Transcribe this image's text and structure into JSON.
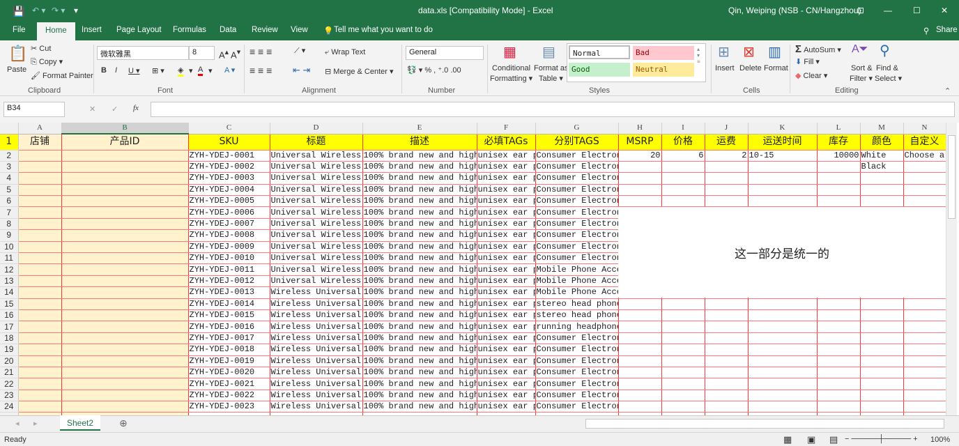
{
  "title": {
    "doc": "data.xls  [Compatibility Mode]  -  Excel",
    "user": "Qin, Weiping (NSB - CN/Hangzhou)"
  },
  "tabs": [
    "File",
    "Home",
    "Insert",
    "Page Layout",
    "Formulas",
    "Data",
    "Review",
    "View"
  ],
  "tell_me": "Tell me what you want to do",
  "share": "Share",
  "ribbon": {
    "paste": "Paste",
    "cut": "Cut",
    "copy": "Copy",
    "format_painter": "Format Painter",
    "font_name": "微软雅黑",
    "font_size": "8",
    "wrap_text": "Wrap Text",
    "merge_center": "Merge & Center",
    "number_format": "General",
    "conditional": "Conditional",
    "formatting": "Formatting",
    "format_as": "Format as",
    "table": "Table",
    "styles": {
      "normal": "Normal",
      "bad": "Bad",
      "good": "Good",
      "neutral": "Neutral"
    },
    "insert": "Insert",
    "delete": "Delete",
    "format": "Format",
    "autosum": "AutoSum",
    "fill": "Fill",
    "clear": "Clear",
    "sort": "Sort &",
    "filter": "Filter",
    "find": "Find &",
    "select": "Select",
    "groups": [
      "Clipboard",
      "Font",
      "Alignment",
      "Number",
      "Styles",
      "Cells",
      "Editing"
    ]
  },
  "formula_bar": {
    "name_box": "B34",
    "formula": ""
  },
  "columns": [
    "A",
    "B",
    "C",
    "D",
    "E",
    "F",
    "G",
    "H",
    "I",
    "J",
    "K",
    "L",
    "M",
    "N"
  ],
  "headers": [
    "店铺",
    "产品ID",
    "SKU",
    "标题",
    "描述",
    "必填TAGs",
    "分别TAGS",
    "MSRP",
    "价格",
    "运费",
    "运送时间",
    "库存",
    "颜色",
    "自定义"
  ],
  "rows": [
    {
      "n": "2",
      "sku": "ZYH-YDEJ-0001",
      "title": "Universal Wireless",
      "desc": "100% brand new and high",
      "tags": "unisex ear p",
      "cat": "Consumer Electron",
      "H": "20",
      "I": "6",
      "J": "2",
      "K": "10-15",
      "L": "10000",
      "M": "White",
      "N": "Choose a"
    },
    {
      "n": "3",
      "sku": "ZYH-YDEJ-0002",
      "title": "Universal Wireless",
      "desc": "100% brand new and high",
      "tags": "unisex ear p",
      "cat": "Consumer Electron",
      "M": "Black"
    },
    {
      "n": "4",
      "sku": "ZYH-YDEJ-0003",
      "title": "Universal Wireless",
      "desc": "100% brand new and high",
      "tags": "unisex ear p",
      "cat": "Consumer Electron"
    },
    {
      "n": "5",
      "sku": "ZYH-YDEJ-0004",
      "title": "Universal Wireless",
      "desc": "100% brand new and high",
      "tags": "unisex ear p",
      "cat": "Consumer Electron"
    },
    {
      "n": "6",
      "sku": "ZYH-YDEJ-0005",
      "title": "Universal Wireless",
      "desc": "100% brand new and high",
      "tags": "unisex ear p",
      "cat": "Consumer Electron"
    },
    {
      "n": "7",
      "sku": "ZYH-YDEJ-0006",
      "title": "Universal Wireless",
      "desc": "100% brand new and high",
      "tags": "unisex ear p",
      "cat": "Consumer Electron"
    },
    {
      "n": "8",
      "sku": "ZYH-YDEJ-0007",
      "title": "Universal Wireless",
      "desc": "100% brand new and high",
      "tags": "unisex ear p",
      "cat": "Consumer Electron"
    },
    {
      "n": "9",
      "sku": "ZYH-YDEJ-0008",
      "title": "Universal Wireless",
      "desc": "100% brand new and high",
      "tags": "unisex ear p",
      "cat": "Consumer Electron"
    },
    {
      "n": "10",
      "sku": "ZYH-YDEJ-0009",
      "title": "Universal Wireless",
      "desc": "100% brand new and high",
      "tags": "unisex ear p",
      "cat": "Consumer Electron"
    },
    {
      "n": "11",
      "sku": "ZYH-YDEJ-0010",
      "title": "Universal Wireless",
      "desc": "100% brand new and high",
      "tags": "unisex ear p",
      "cat": "Consumer Electron"
    },
    {
      "n": "12",
      "sku": "ZYH-YDEJ-0011",
      "title": "Universal Wireless",
      "desc": "100% brand new and high",
      "tags": "unisex ear p",
      "cat": "Mobile Phone Acce"
    },
    {
      "n": "13",
      "sku": "ZYH-YDEJ-0012",
      "title": "Universal Wireless",
      "desc": "100% brand new and high",
      "tags": "unisex ear p",
      "cat": "Mobile Phone Acce"
    },
    {
      "n": "14",
      "sku": "ZYH-YDEJ-0013",
      "title": "Wireless Universal",
      "desc": "100% brand new and high",
      "tags": "unisex ear p",
      "cat": "Mobile Phone Acce"
    },
    {
      "n": "15",
      "sku": "ZYH-YDEJ-0014",
      "title": "Wireless Universal",
      "desc": "100% brand new and high",
      "tags": "unisex ear p",
      "cat": "stereo head phone"
    },
    {
      "n": "16",
      "sku": "ZYH-YDEJ-0015",
      "title": "Wireless Universal",
      "desc": "100% brand new and high",
      "tags": "unisex ear p",
      "cat": "stereo head phone"
    },
    {
      "n": "17",
      "sku": "ZYH-YDEJ-0016",
      "title": "Wireless Universal",
      "desc": "100% brand new and high",
      "tags": "unisex ear p",
      "cat": "running headphone"
    },
    {
      "n": "18",
      "sku": "ZYH-YDEJ-0017",
      "title": "Wireless Universal",
      "desc": "100% brand new and high",
      "tags": "unisex ear p",
      "cat": "Consumer Electron"
    },
    {
      "n": "19",
      "sku": "ZYH-YDEJ-0018",
      "title": "Wireless Universal",
      "desc": "100% brand new and high",
      "tags": "unisex ear p",
      "cat": "Consumer Electron"
    },
    {
      "n": "20",
      "sku": "ZYH-YDEJ-0019",
      "title": "Wireless Universal",
      "desc": "100% brand new and high",
      "tags": "unisex ear p",
      "cat": "Consumer Electron"
    },
    {
      "n": "21",
      "sku": "ZYH-YDEJ-0020",
      "title": "Wireless Universal",
      "desc": "100% brand new and high",
      "tags": "unisex ear p",
      "cat": "Consumer Electron"
    },
    {
      "n": "22",
      "sku": "ZYH-YDEJ-0021",
      "title": "Wireless Universal",
      "desc": "100% brand new and high",
      "tags": "unisex ear p",
      "cat": "Consumer Electron"
    },
    {
      "n": "23",
      "sku": "ZYH-YDEJ-0022",
      "title": "Wireless Universal",
      "desc": "100% brand new and high",
      "tags": "unisex ear p",
      "cat": "Consumer Electron"
    },
    {
      "n": "24",
      "sku": "ZYH-YDEJ-0023",
      "title": "Wireless Universal",
      "desc": "100% brand new and high",
      "tags": "unisex ear p",
      "cat": "Consumer Electron"
    }
  ],
  "merged_note": "这一部分是统一的",
  "sheet_tab": "Sheet2",
  "status": {
    "ready": "Ready",
    "zoom": "100%"
  },
  "colors": {
    "excel_green": "#217346",
    "header_fill": "#ffff00",
    "side_fill": "#fff2cc",
    "border": "#ff3333"
  }
}
